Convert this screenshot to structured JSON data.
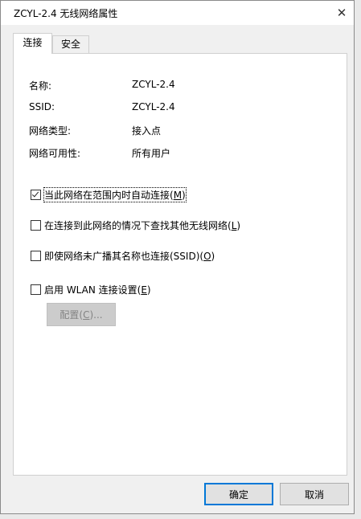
{
  "window": {
    "title": "ZCYL-2.4 无线网络属性",
    "close_glyph": "✕"
  },
  "tabs": [
    {
      "label": "连接",
      "active": true
    },
    {
      "label": "安全",
      "active": false
    }
  ],
  "info": [
    {
      "label": "名称:",
      "value": "ZCYL-2.4"
    },
    {
      "label": "SSID:",
      "value": "ZCYL-2.4"
    },
    {
      "label": "网络类型:",
      "value": "接入点"
    },
    {
      "label": "网络可用性:",
      "value": "所有用户"
    }
  ],
  "options": [
    {
      "label": "当此网络在范围内时自动连接(",
      "key": "M",
      "suffix": ")",
      "checked": true
    },
    {
      "label": "在连接到此网络的情况下查找其他无线网络(",
      "key": "L",
      "suffix": ")",
      "checked": false
    },
    {
      "label": "即使网络未广播其名称也连接(SSID)(",
      "key": "O",
      "suffix": ")",
      "checked": false
    },
    {
      "label": "启用 WLAN 连接设置(",
      "key": "E",
      "suffix": ")",
      "checked": false
    }
  ],
  "config_button": {
    "label": "配置(",
    "key": "C",
    "suffix": ")..."
  },
  "buttons": {
    "ok": "确定",
    "cancel": "取消"
  },
  "colors": {
    "focus_border": "#0078d7",
    "disabled_button": "#cccccc"
  }
}
